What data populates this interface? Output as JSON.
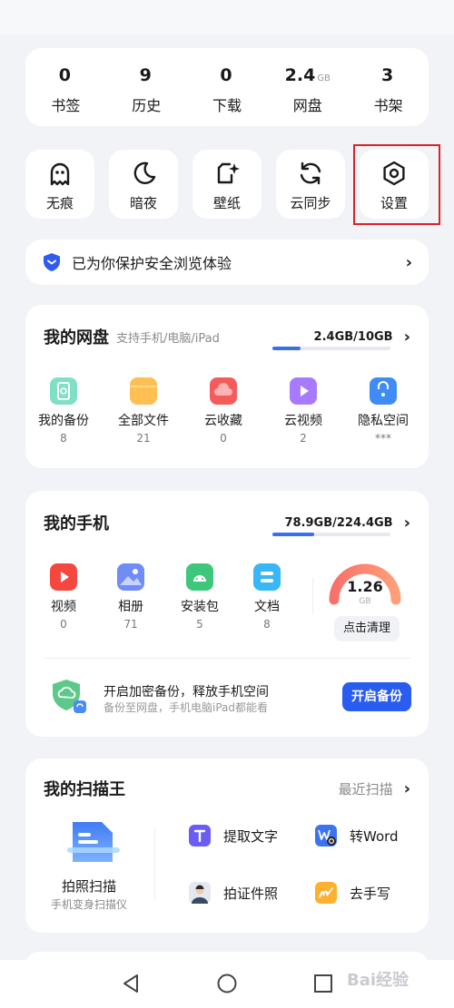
{
  "stats": [
    {
      "value": "0",
      "unit": "",
      "label": "书签"
    },
    {
      "value": "9",
      "unit": "",
      "label": "历史"
    },
    {
      "value": "0",
      "unit": "",
      "label": "下载"
    },
    {
      "value": "2.4",
      "unit": "GB",
      "label": "网盘"
    },
    {
      "value": "3",
      "unit": "",
      "label": "书架"
    }
  ],
  "tools": [
    {
      "label": "无痕",
      "icon": "ghost-icon"
    },
    {
      "label": "暗夜",
      "icon": "moon-icon"
    },
    {
      "label": "壁纸",
      "icon": "wallpaper-icon"
    },
    {
      "label": "云同步",
      "icon": "sync-icon"
    },
    {
      "label": "设置",
      "icon": "gear-icon"
    }
  ],
  "safety": {
    "text": "已为你保护安全浏览体验",
    "icon": "shield-icon"
  },
  "cloud": {
    "title": "我的网盘",
    "subtitle": "支持手机/电脑/iPad",
    "usage": "2.4GB/10GB",
    "usage_fraction": 0.24,
    "items": [
      {
        "label": "我的备份",
        "count": "8",
        "icon": "backup-icon",
        "color": "#7fe0c6"
      },
      {
        "label": "全部文件",
        "count": "21",
        "icon": "folder-icon",
        "color": "#ffbf52"
      },
      {
        "label": "云收藏",
        "count": "0",
        "icon": "cloud-favorite-icon",
        "color": "#f45b5b"
      },
      {
        "label": "云视频",
        "count": "2",
        "icon": "cloud-video-icon",
        "color": "#a77bff"
      },
      {
        "label": "隐私空间",
        "count": "***",
        "icon": "lock-icon",
        "color": "#3f8cf7"
      }
    ]
  },
  "phone": {
    "title": "我的手机",
    "usage": "78.9GB/224.4GB",
    "usage_fraction": 0.35,
    "items": [
      {
        "label": "视频",
        "count": "0",
        "icon": "video-icon",
        "color": "#f4483f"
      },
      {
        "label": "相册",
        "count": "71",
        "icon": "album-icon",
        "color": "#6f8cf7"
      },
      {
        "label": "安装包",
        "count": "5",
        "icon": "apk-icon",
        "color": "#3ec77a"
      },
      {
        "label": "文档",
        "count": "8",
        "icon": "document-icon",
        "color": "#38b6f5"
      }
    ],
    "junk_value": "1.26",
    "junk_unit": "GB",
    "clean_label": "点击清理",
    "backup_title": "开启加密备份，释放手机空间",
    "backup_subtitle": "备份至网盘，手机电脑iPad都能看",
    "backup_button": "开启备份"
  },
  "scanner": {
    "title": "我的扫描王",
    "recent": "最近扫描",
    "photo_label": "拍照扫描",
    "photo_sub": "手机变身扫描仪",
    "items": [
      {
        "label": "提取文字",
        "icon": "text-extract-icon",
        "color": "#6a5cf5"
      },
      {
        "label": "转Word",
        "icon": "word-icon",
        "color": "#3a74f2"
      },
      {
        "label": "拍证件照",
        "icon": "id-photo-icon",
        "color": "#8fa4c4"
      },
      {
        "label": "去手写",
        "icon": "remove-handwriting-icon",
        "color": "#ffb02e"
      }
    ]
  },
  "navbar": {
    "back": "back-icon",
    "home": "home-icon",
    "recent": "recent-apps-icon"
  },
  "watermark": "Bai经验"
}
